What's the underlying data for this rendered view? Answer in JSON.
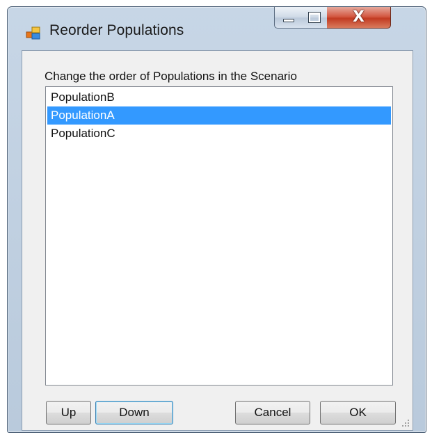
{
  "window": {
    "title": "Reorder Populations"
  },
  "dialog": {
    "instruction": "Change the order of Populations in the Scenario",
    "populations": [
      {
        "label": "PopulationB",
        "selected": false
      },
      {
        "label": "PopulationA",
        "selected": true
      },
      {
        "label": "PopulationC",
        "selected": false
      }
    ]
  },
  "buttons": {
    "up": "Up",
    "down": "Down",
    "cancel": "Cancel",
    "ok": "OK"
  },
  "caption": {
    "close_glyph": "X"
  },
  "colors": {
    "selection": "#3399ff",
    "close": "#c23b22"
  }
}
